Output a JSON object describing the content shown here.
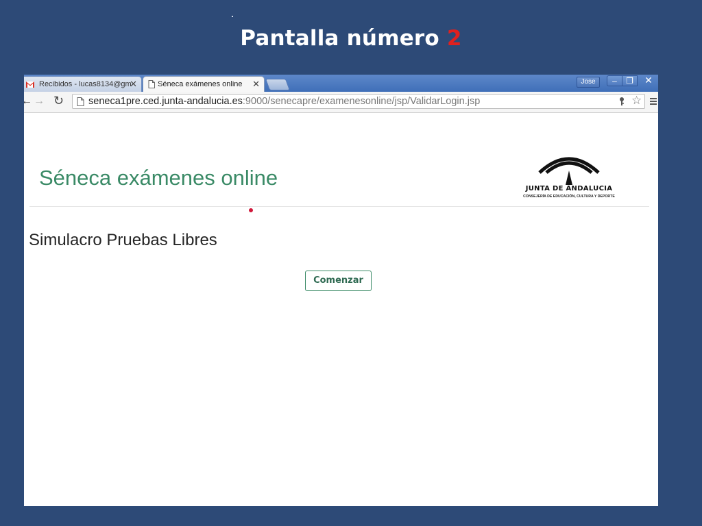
{
  "slide": {
    "title_prefix": "Pantalla número",
    "title_number": "2"
  },
  "browser": {
    "tabs": [
      {
        "label": "Recibidos - lucas8134@gm",
        "icon": "gmail-icon",
        "active": false
      },
      {
        "label": "Séneca exámenes online",
        "icon": "page-icon",
        "active": true
      }
    ],
    "tab_close": "✕",
    "user_name": "Jose",
    "window_controls": {
      "minimize": "–",
      "maximize": "❐",
      "close": "✕"
    },
    "address": {
      "host": "seneca1pre.ced.junta-andalucia.es",
      "rest": ":9000/senecapre/examenesonline/jsp/ValidarLogin.jsp"
    }
  },
  "page": {
    "heading": "Séneca exámenes online",
    "logo": {
      "line1": "JUNTA DE ANDALUCIA",
      "line2": "CONSEJERÍA DE EDUCACIÓN, CULTURA Y DEPORTE"
    },
    "section_title": "Simulacro Pruebas Libres",
    "start_button": "Comenzar"
  },
  "colors": {
    "slide_background": "#2d4a77",
    "title_number": "#e0201f",
    "heading_green": "#3a8a66",
    "red_dot": "#d0183a"
  }
}
